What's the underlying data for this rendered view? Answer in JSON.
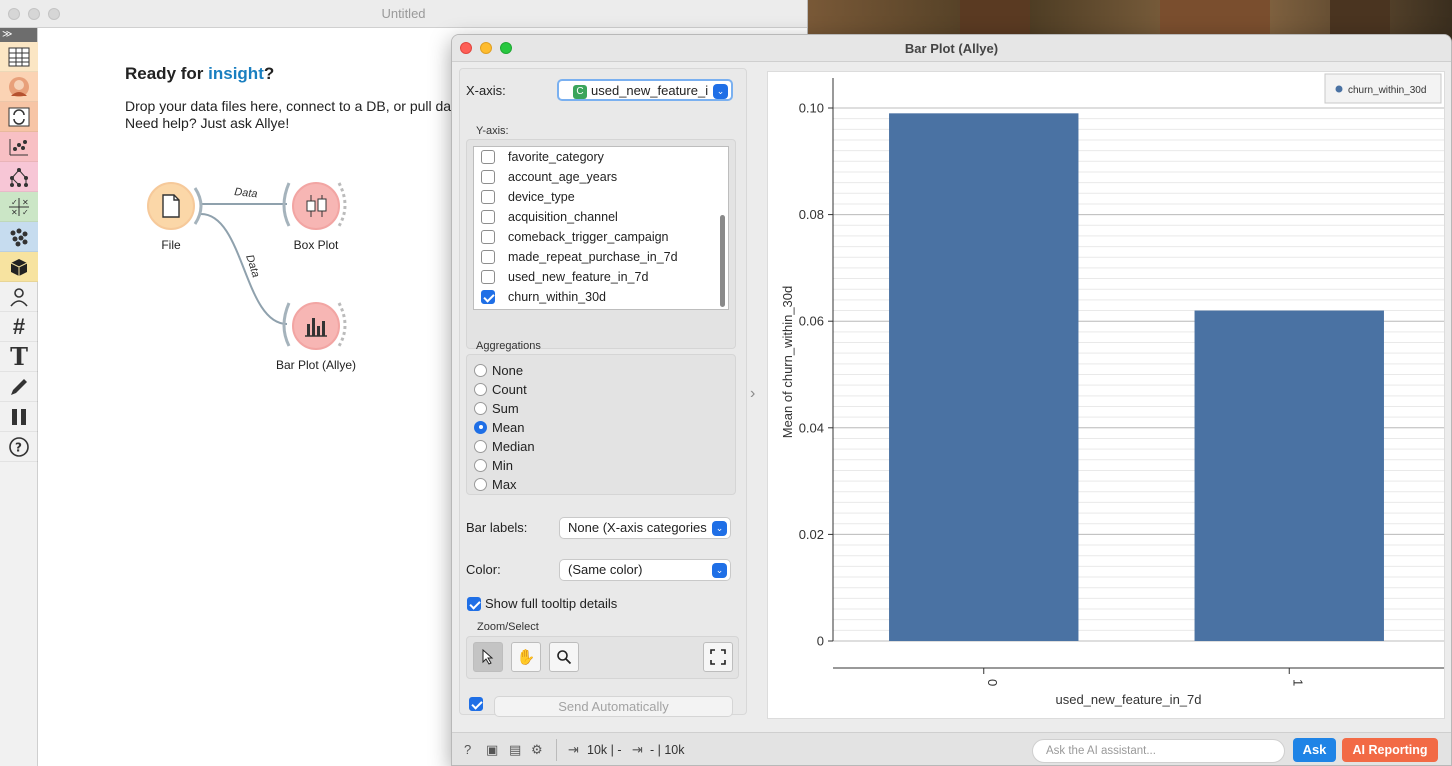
{
  "main_window": {
    "title": "Untitled",
    "welcome_title_prefix": "Ready for ",
    "welcome_title_accent": "insight",
    "welcome_title_suffix": "?",
    "welcome_line1": "Drop your data files here, connect to a DB, or pull da",
    "welcome_line2": "Need help? Just ask Allye!",
    "toolbox_expand": "≫",
    "nodes": {
      "file": "File",
      "box_plot": "Box Plot",
      "bar_plot": "Bar Plot (Allye)"
    },
    "links": {
      "link1": "Data",
      "link2": "Data"
    }
  },
  "dialog": {
    "title": "Bar Plot (Allye)",
    "x_axis_label": "X-axis:",
    "x_axis_value": "used_new_feature_i",
    "x_axis_type_badge": "C",
    "y_axis_label": "Y-axis:",
    "y_axis_items": [
      {
        "name": "favorite_category",
        "checked": false
      },
      {
        "name": "account_age_years",
        "checked": false
      },
      {
        "name": "device_type",
        "checked": false
      },
      {
        "name": "acquisition_channel",
        "checked": false
      },
      {
        "name": "comeback_trigger_campaign",
        "checked": false
      },
      {
        "name": "made_repeat_purchase_in_7d",
        "checked": false
      },
      {
        "name": "used_new_feature_in_7d",
        "checked": false
      },
      {
        "name": "churn_within_30d",
        "checked": true
      }
    ],
    "aggregations_label": "Aggregations",
    "aggregations": [
      "None",
      "Count",
      "Sum",
      "Mean",
      "Median",
      "Min",
      "Max"
    ],
    "aggregation_selected": "Mean",
    "bar_labels_label": "Bar labels:",
    "bar_labels_value": "None (X-axis categories",
    "color_label": "Color:",
    "color_value": "(Same color)",
    "tooltip_label": "Show full tooltip details",
    "zoom_select_label": "Zoom/Select",
    "send_auto_label": "Send Automatically"
  },
  "statusbar": {
    "input_count": "10k | -",
    "output_count": "- | 10k",
    "ask_placeholder": "Ask the AI assistant...",
    "ask_button": "Ask",
    "ai_reporting_button": "AI Reporting"
  },
  "colors": {
    "bar": "#4a72a3",
    "accent_blue": "#1f6fe6",
    "ai_reporting": "#f26a45",
    "insight": "#1a7fc0"
  },
  "chart_data": {
    "type": "bar",
    "categories": [
      "0",
      "1"
    ],
    "series": [
      {
        "name": "churn_within_30d",
        "values": [
          0.099,
          0.062
        ]
      }
    ],
    "xlabel": "used_new_feature_in_7d",
    "ylabel": "Mean of churn_within_30d",
    "ylim": [
      0,
      0.1
    ],
    "yticks": [
      "0",
      "0.02",
      "0.04",
      "0.06",
      "0.08",
      "0.10"
    ],
    "ytick_values": [
      0,
      0.02,
      0.04,
      0.06,
      0.08,
      0.1
    ],
    "grid": true,
    "legend": "top-right"
  }
}
